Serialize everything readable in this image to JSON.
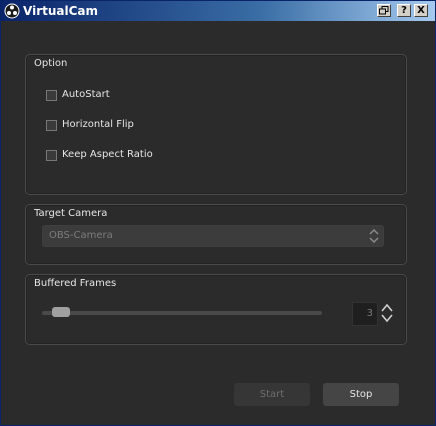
{
  "window": {
    "title": "VirtualCam"
  },
  "titlebar_buttons": [
    "?",
    "X"
  ],
  "option_group": {
    "title": "Option",
    "checkboxes": [
      {
        "label": "AutoStart",
        "checked": false
      },
      {
        "label": "Horizontal Flip",
        "checked": false
      },
      {
        "label": "Keep Aspect Ratio",
        "checked": false
      }
    ]
  },
  "target_camera": {
    "title": "Target Camera",
    "selected": "OBS-Camera"
  },
  "buffered_frames": {
    "title": "Buffered Frames",
    "value": "3"
  },
  "buttons": {
    "start": "Start",
    "stop": "Stop"
  }
}
